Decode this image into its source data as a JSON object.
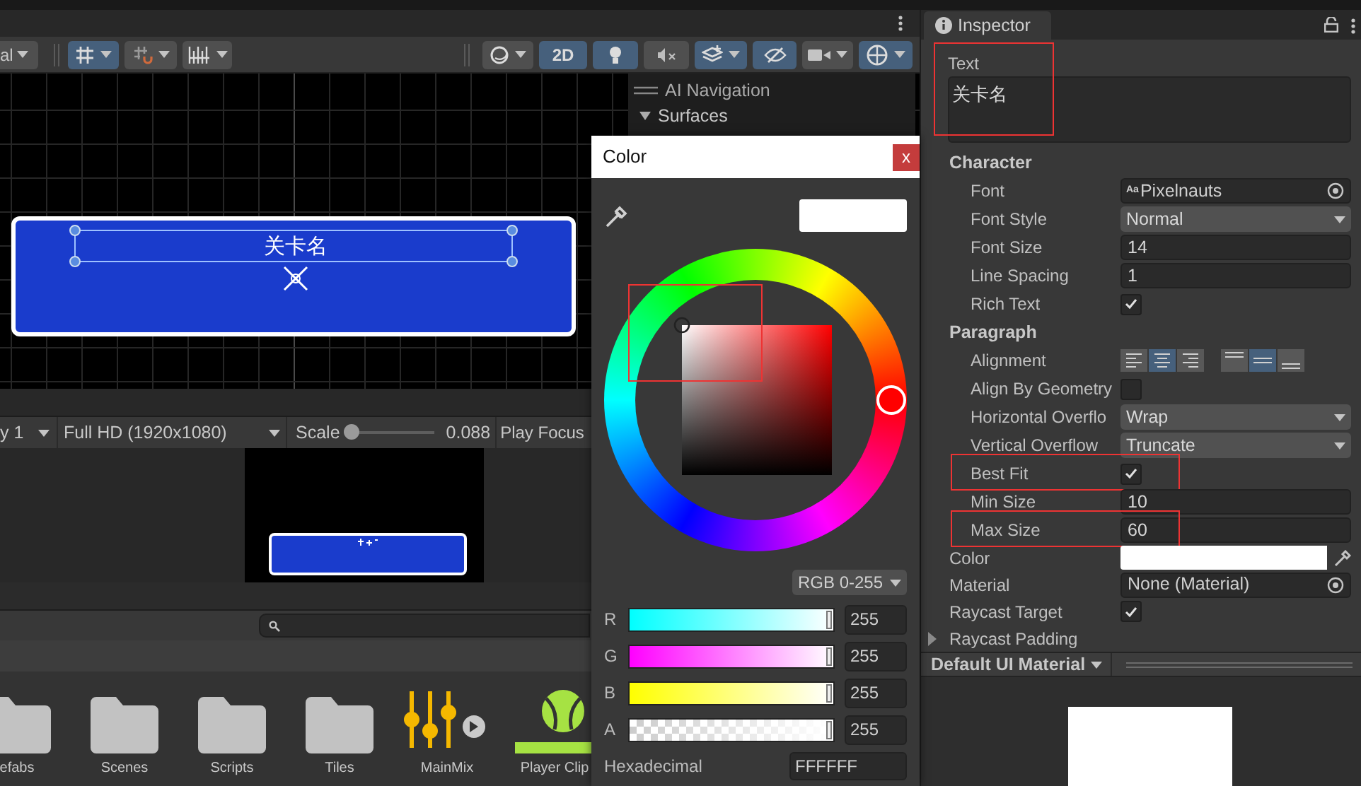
{
  "scene_toolbar": {
    "mode_dropdown": "al",
    "buttons": [
      {
        "kind": "grid-snap",
        "on": true
      },
      {
        "kind": "increment-snap",
        "on": false
      },
      {
        "kind": "ruler",
        "on": false
      },
      {
        "kind": "shading",
        "on": false
      },
      {
        "kind": "dimension",
        "label": "2D",
        "on": true
      },
      {
        "kind": "light",
        "on": true
      },
      {
        "kind": "audio",
        "on": false
      },
      {
        "kind": "effects",
        "on": true
      },
      {
        "kind": "visibility",
        "on": true
      },
      {
        "kind": "camera",
        "on": false
      },
      {
        "kind": "gizmos",
        "on": true
      }
    ]
  },
  "scene": {
    "button_text": "关卡名"
  },
  "overlay": {
    "title": "AI Navigation",
    "section": "Surfaces",
    "expanded": true
  },
  "game_toolbar": {
    "display": "y 1",
    "resolution": "Full HD (1920x1080)",
    "scale_label": "Scale",
    "scale": {
      "level": 0
    },
    "scale_value": "0.088",
    "play_focus": "Play Focus"
  },
  "project": {
    "items": [
      {
        "name": "efabs",
        "kind": "folder"
      },
      {
        "name": "Scenes",
        "kind": "folder"
      },
      {
        "name": "Scripts",
        "kind": "folder"
      },
      {
        "name": "Tiles",
        "kind": "folder"
      },
      {
        "name": "MainMix",
        "kind": "mixer"
      },
      {
        "name": "Player Clip",
        "kind": "clip"
      }
    ]
  },
  "color_picker": {
    "title": "Color",
    "close": "x",
    "wheel_highlighted": true,
    "mode": "RGB 0-255",
    "channels": [
      {
        "label": "R",
        "value": "255",
        "level": 1
      },
      {
        "label": "G",
        "value": "255",
        "level": 1
      },
      {
        "label": "B",
        "value": "255",
        "level": 1
      },
      {
        "label": "A",
        "value": "255",
        "level": 1
      }
    ],
    "hex_label": "Hexadecimal",
    "hex_value": "FFFFFF"
  },
  "inspector": {
    "tab": "Inspector",
    "text_label": "Text",
    "text_value": "关卡名",
    "text_highlighted": true,
    "sections": [
      {
        "title": "Character",
        "rows": [
          {
            "label": "Font",
            "kind": "object",
            "icon_text": "Aa",
            "value": "Pixelnauts",
            "highlighted": false
          },
          {
            "label": "Font Style",
            "kind": "dropdown",
            "value": "Normal",
            "highlighted": false
          },
          {
            "label": "Font Size",
            "kind": "number",
            "value": "14",
            "highlighted": false
          },
          {
            "label": "Line Spacing",
            "kind": "number",
            "value": "1",
            "highlighted": false
          },
          {
            "label": "Rich Text",
            "kind": "checkbox",
            "checked": true,
            "highlighted": false
          }
        ]
      },
      {
        "title": "Paragraph",
        "rows": [
          {
            "label": "Alignment",
            "kind": "alignment",
            "horizontal": [
              {
                "selected": false
              },
              {
                "selected": true
              },
              {
                "selected": false
              }
            ],
            "vertical": [
              {
                "selected": false
              },
              {
                "selected": true
              },
              {
                "selected": false
              }
            ],
            "highlighted": false
          },
          {
            "label": "Align By Geometry",
            "kind": "checkbox",
            "checked": false,
            "highlighted": false
          },
          {
            "label": "Horizontal Overflo",
            "kind": "dropdown",
            "value": "Wrap",
            "highlighted": false
          },
          {
            "label": "Vertical Overflow",
            "kind": "dropdown",
            "value": "Truncate",
            "highlighted": false
          },
          {
            "label": "Best Fit",
            "kind": "checkbox",
            "checked": true,
            "highlighted": true
          },
          {
            "label": "Min Size",
            "kind": "number",
            "value": "10",
            "highlighted": false
          },
          {
            "label": "Max Size",
            "kind": "number",
            "value": "60",
            "highlighted": true
          }
        ]
      }
    ],
    "rows": [
      {
        "label": "Color",
        "kind": "color"
      },
      {
        "label": "Material",
        "kind": "object",
        "value": "None (Material)"
      },
      {
        "label": "Raycast Target",
        "kind": "checkbox",
        "checked": true
      },
      {
        "label": "Raycast Padding",
        "kind": "foldout",
        "expanded": false
      }
    ],
    "material_bar": "Default UI Material"
  }
}
